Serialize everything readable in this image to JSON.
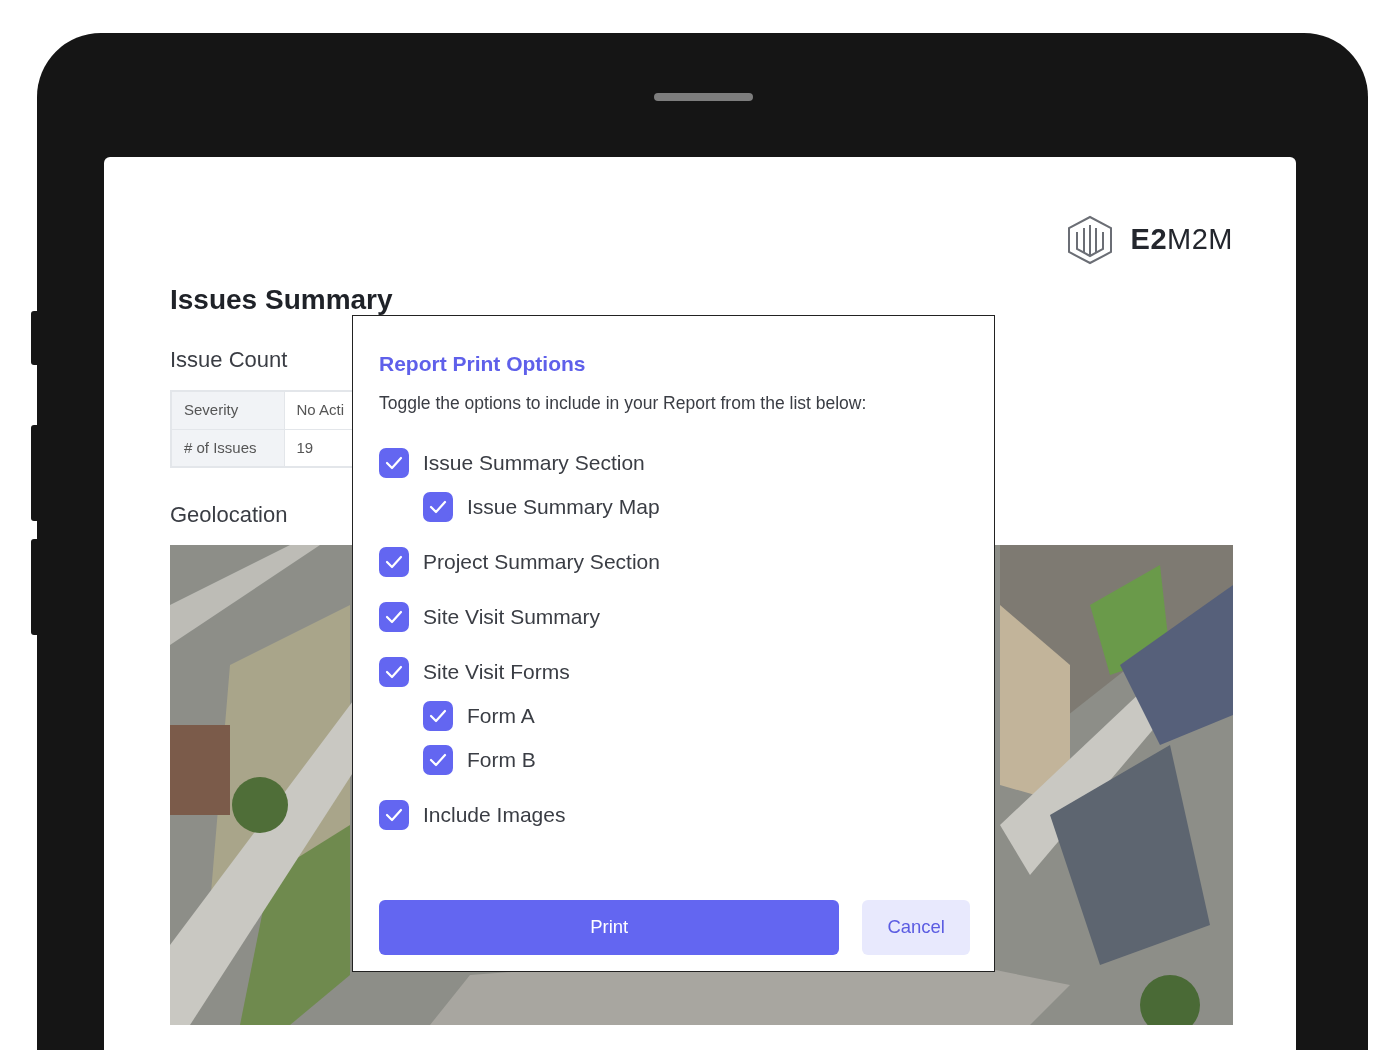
{
  "logo": {
    "text": "**E2**M2M"
  },
  "page": {
    "title": "Issues Summary",
    "issue_count_heading": "Issue Count",
    "geolocation_heading": "Geolocation"
  },
  "issue_table": {
    "rows": [
      [
        "Severity",
        "No Acti"
      ],
      [
        "# of Issues",
        "19"
      ]
    ]
  },
  "dialog": {
    "title": "Report Print Options",
    "subtitle": "Toggle the options to include in your Report from the list below:",
    "options": [
      {
        "label": "Issue Summary Section",
        "checked": true,
        "children": [
          {
            "label": "Issue Summary Map",
            "checked": true
          }
        ]
      },
      {
        "label": "Project Summary Section",
        "checked": true
      },
      {
        "label": "Site Visit Summary",
        "checked": true
      },
      {
        "label": "Site Visit Forms",
        "checked": true,
        "children": [
          {
            "label": "Form A",
            "checked": true
          },
          {
            "label": "Form B",
            "checked": true
          }
        ]
      },
      {
        "label": "Include Images",
        "checked": true
      }
    ],
    "buttons": [
      {
        "label": "Print",
        "kind": "primary"
      },
      {
        "label": "Cancel",
        "kind": "secondary"
      }
    ]
  }
}
